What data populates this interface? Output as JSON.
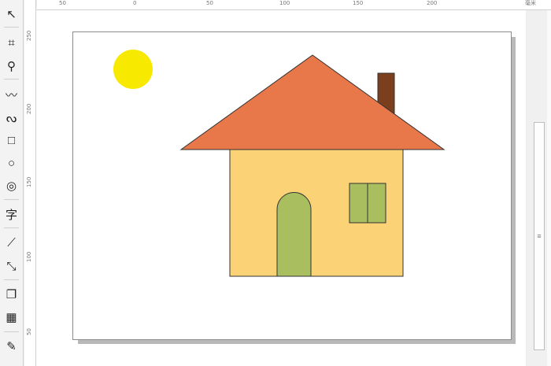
{
  "toolbox": {
    "tools": [
      {
        "name": "pick-tool",
        "glyph": "↖"
      },
      {
        "name": "crop-tool",
        "glyph": "⌗"
      },
      {
        "name": "zoom-tool",
        "glyph": "⚲"
      },
      {
        "name": "freehand-tool",
        "glyph": "〰"
      },
      {
        "name": "artistic-media-tool",
        "glyph": "ᔓ"
      },
      {
        "name": "rectangle-tool",
        "glyph": "□"
      },
      {
        "name": "ellipse-tool",
        "glyph": "○"
      },
      {
        "name": "spiral-tool",
        "glyph": "◎"
      },
      {
        "name": "text-tool",
        "glyph": "字"
      },
      {
        "name": "dimension-tool",
        "glyph": "⟋"
      },
      {
        "name": "connector-tool",
        "glyph": "⤡"
      },
      {
        "name": "drop-shadow-tool",
        "glyph": "❐"
      },
      {
        "name": "transparency-tool",
        "glyph": "▦"
      },
      {
        "name": "eyedropper-tool",
        "glyph": "✎"
      }
    ]
  },
  "ruler_top": {
    "labels": [
      "50",
      "0",
      "50",
      "100",
      "150",
      "200",
      "毫米"
    ]
  },
  "ruler_left": {
    "labels": [
      "250",
      "200",
      "150",
      "100",
      "50"
    ]
  },
  "drawing": {
    "sun_color": "#f7ea00",
    "roof_color": "#e8774a",
    "wall_color": "#fbd276",
    "door_color": "#a9bf5f",
    "window_color": "#a9bf5f",
    "chimney_color": "#7b3f1e",
    "outline_color": "#333333"
  }
}
